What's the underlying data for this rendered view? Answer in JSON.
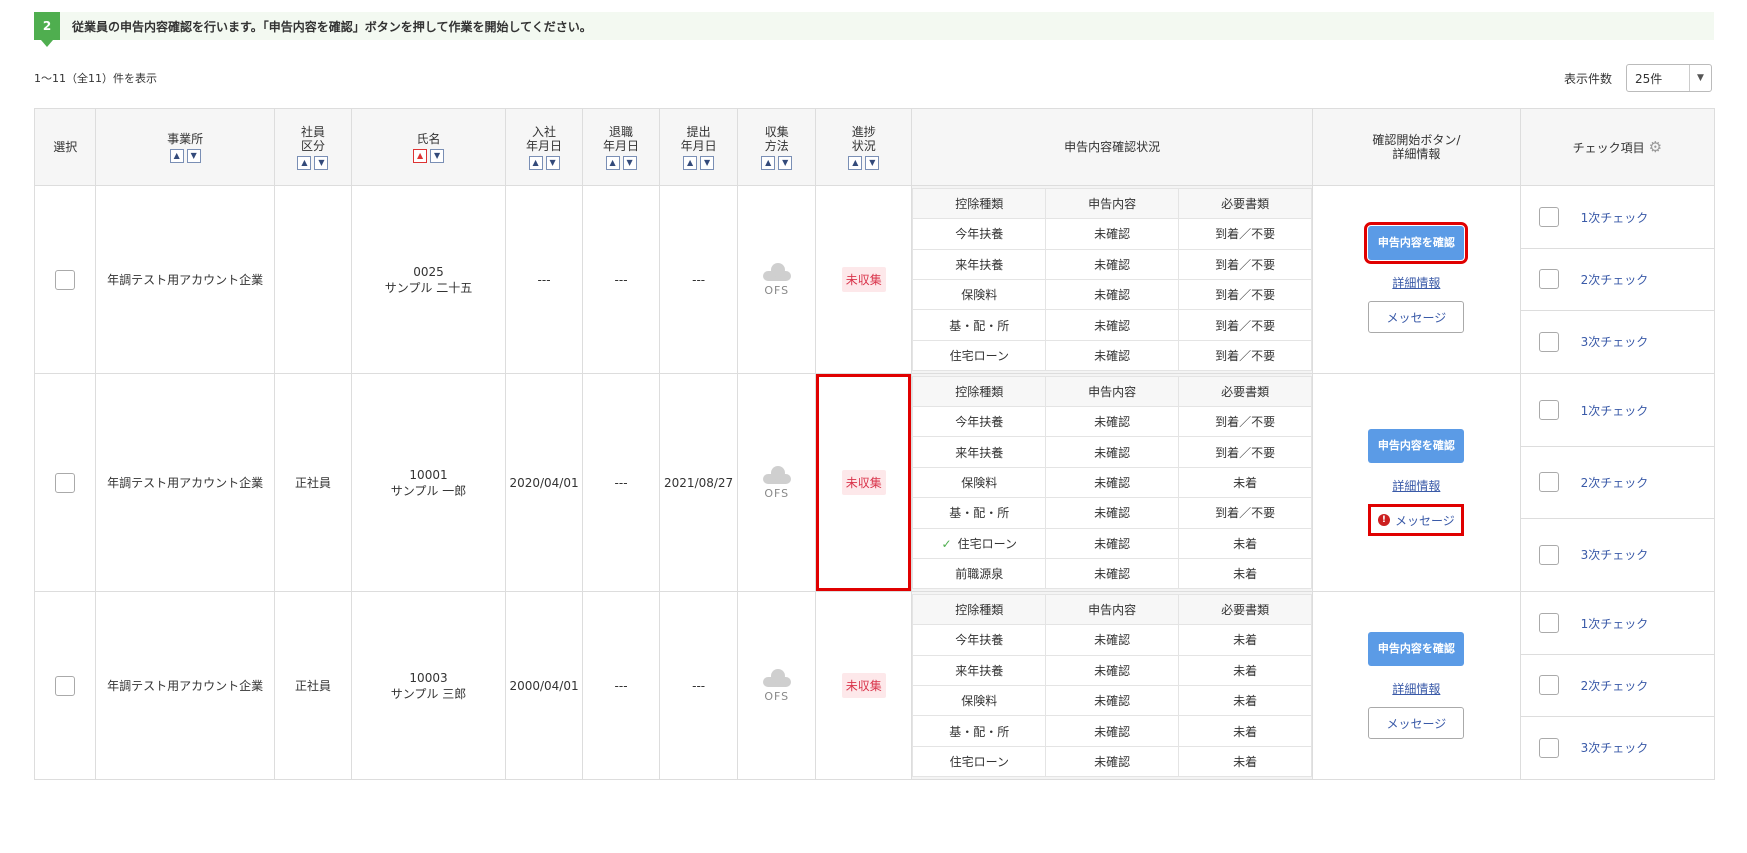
{
  "step": {
    "number": "2",
    "text": "従業員の申告内容確認を行います。「申告内容を確認」ボタンを押して作業を開始してください。"
  },
  "list": {
    "count_text": "1〜11（全11）件を表示",
    "per_page_label": "表示件数",
    "per_page_value": "25件"
  },
  "headers": {
    "select": "選択",
    "office": "事業所",
    "emp_type_1": "社員",
    "emp_type_2": "区分",
    "name": "氏名",
    "join_1": "入社",
    "join_2": "年月日",
    "leave_1": "退職",
    "leave_2": "年月日",
    "submit_1": "提出",
    "submit_2": "年月日",
    "collect_1": "収集",
    "collect_2": "方法",
    "progress_1": "進捗",
    "progress_2": "状況",
    "decl_status": "申告内容確認状況",
    "action_1": "確認開始ボタン/",
    "action_2": "詳細情報",
    "check_items": "チェック項目"
  },
  "inner_headers": {
    "type": "控除種類",
    "content": "申告内容",
    "docs": "必要書類"
  },
  "buttons": {
    "confirm": "申告内容を確認",
    "detail": "詳細情報",
    "message": "メッセージ"
  },
  "checks": [
    "1次チェック",
    "2次チェック",
    "3次チェック"
  ],
  "rows": [
    {
      "office": "年調テスト用アカウント企業",
      "emp_type": "",
      "emp_no": "0025",
      "emp_name": "サンプル 二十五",
      "join": "---",
      "leave": "---",
      "submit": "---",
      "collect": "OFS",
      "status": "未収集",
      "decl": [
        {
          "type": "今年扶養",
          "content": "未確認",
          "docs": "到着／不要"
        },
        {
          "type": "来年扶養",
          "content": "未確認",
          "docs": "到着／不要"
        },
        {
          "type": "保険料",
          "content": "未確認",
          "docs": "到着／不要"
        },
        {
          "type": "基・配・所",
          "content": "未確認",
          "docs": "到着／不要"
        },
        {
          "type": "住宅ローン",
          "content": "未確認",
          "docs": "到着／不要"
        }
      ]
    },
    {
      "office": "年調テスト用アカウント企業",
      "emp_type": "正社員",
      "emp_no": "10001",
      "emp_name": "サンプル 一郎",
      "join": "2020/04/01",
      "leave": "---",
      "submit": "2021/08/27",
      "collect": "OFS",
      "status": "未収集",
      "decl": [
        {
          "type": "今年扶養",
          "content": "未確認",
          "docs": "到着／不要"
        },
        {
          "type": "来年扶養",
          "content": "未確認",
          "docs": "到着／不要"
        },
        {
          "type": "保険料",
          "content": "未確認",
          "docs": "未着"
        },
        {
          "type": "基・配・所",
          "content": "未確認",
          "docs": "到着／不要"
        },
        {
          "type": "住宅ローン",
          "content": "未確認",
          "docs": "未着"
        },
        {
          "type": "前職源泉",
          "content": "未確認",
          "docs": "未着"
        }
      ]
    },
    {
      "office": "年調テスト用アカウント企業",
      "emp_type": "正社員",
      "emp_no": "10003",
      "emp_name": "サンプル 三郎",
      "join": "2000/04/01",
      "leave": "---",
      "submit": "---",
      "collect": "OFS",
      "status": "未収集",
      "decl": [
        {
          "type": "今年扶養",
          "content": "未確認",
          "docs": "未着"
        },
        {
          "type": "来年扶養",
          "content": "未確認",
          "docs": "未着"
        },
        {
          "type": "保険料",
          "content": "未確認",
          "docs": "未着"
        },
        {
          "type": "基・配・所",
          "content": "未確認",
          "docs": "未着"
        },
        {
          "type": "住宅ローン",
          "content": "未確認",
          "docs": "未着"
        }
      ]
    }
  ],
  "colors": {
    "accent_green": "#4fae4f",
    "button_blue": "#5b9be6",
    "highlight_red": "#e00000",
    "status_red": "#d9334a"
  }
}
